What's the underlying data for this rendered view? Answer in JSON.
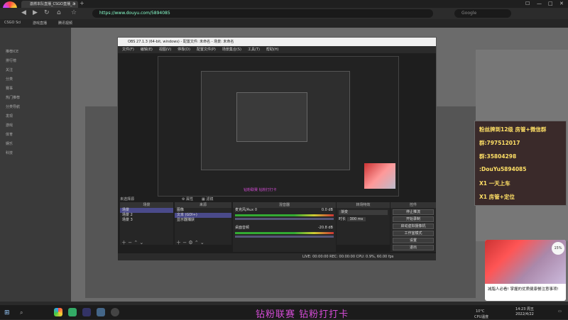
{
  "browser": {
    "tab_title": "激燃本队直播_CSGO直播_斗",
    "address": "https://www.douyu.com/5894085",
    "search_placeholder": "Google",
    "bookmarks": [
      "CSGO Sci",
      "游戏直播",
      "腾讯视频"
    ],
    "new_tab": "+",
    "window_controls": [
      "☐",
      "—",
      "□",
      "✕"
    ]
  },
  "page": {
    "sidebar_items": [
      "推荐ICE",
      "排行榜",
      "关注",
      "分类",
      "赛事",
      "热门推荐",
      "分类导航",
      "发现",
      "游戏",
      "体育",
      "娱乐",
      "科技"
    ],
    "stream_ticker": "钻粉联赛  钻粉打打卡",
    "preview_ticker": "钻粉联赛  钻粉打打卡"
  },
  "obs": {
    "title": "OBS 27.1.3 (64-bit, windows) - 配置文件: 未命名 - 场景: 未命名",
    "menu": [
      "文件(F)",
      "编辑(E)",
      "视图(V)",
      "停靠(D)",
      "配置文件(P)",
      "场景集合(S)",
      "工具(T)",
      "帮助(H)"
    ],
    "status_label": "未选择源",
    "scenes_header": "场景",
    "scenes": [
      "场景",
      "场景 2",
      "场景 3"
    ],
    "sources_header": "来源",
    "sources": [
      "图像",
      "文本 (GDI+)",
      "显示器捕获"
    ],
    "mixer_header": "混音器",
    "mixer": [
      {
        "name": "麦克风/Aux 0",
        "db": "0.0 dB"
      },
      {
        "name": "桌面音频",
        "db": "-20.8 dB"
      }
    ],
    "trans_header": "转场特效",
    "trans_type": "渐变",
    "trans_duration_label": "时长",
    "trans_duration": "300 ms",
    "controls_header": "控件",
    "controls": [
      "停止推流",
      "开始录制",
      "启动虚拟摄像机",
      "工作室模式",
      "设置",
      "退出"
    ],
    "statusbar": "LIVE: 00:00:00    REC: 00:00:00    CPU: 0.9%, 60.00 fps"
  },
  "fan_panel": {
    "lines": [
      "粉丝牌到12级 房管+微信群",
      "群:797512017",
      "群:35804298",
      ":DouYu5894085",
      "X1 一天上车",
      "X1 房管+定位"
    ]
  },
  "ad": {
    "badge": "15%",
    "text": "减脂人必看! 掌握的优质健康餐注意事项!"
  },
  "taskbar": {
    "clock_time": "14:23 周五",
    "clock_date": "2022/4/22",
    "weather": "10°C",
    "cpu_label": "CPU温度"
  },
  "colors": {
    "accent": "#d44cd6",
    "obs_bg": "#1e1e1e",
    "gold": "#ffe066"
  }
}
